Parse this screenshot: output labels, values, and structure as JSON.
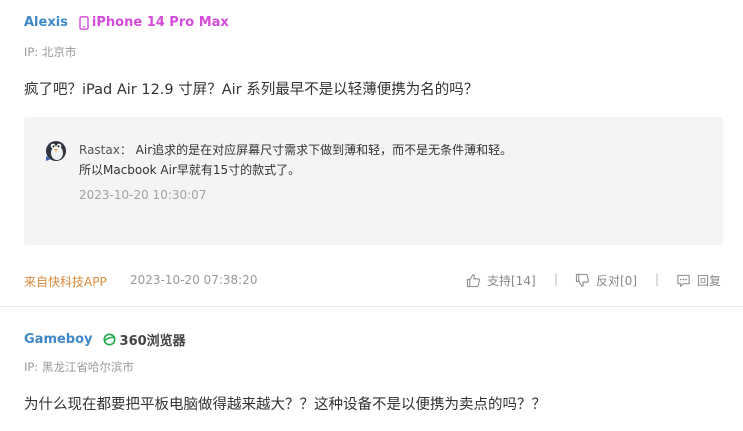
{
  "comments": [
    {
      "username": "Alexis",
      "device": "iPhone 14 Pro Max",
      "device_icon": "phone-icon",
      "ip": "IP: 北京市",
      "content": "疯了吧？iPad Air 12.9 寸屏？Air 系列最早不是以轻薄便携为名的吗？",
      "quote": {
        "avatar_icon": "penguin-avatar",
        "name": "Rastax：",
        "text_line1": "Air追求的是在对应屏幕尺寸需求下做到薄和轻，而不是无条件薄和轻。",
        "text_line2": "所以Macbook Air早就有15寸的款式了。",
        "time": "2023-10-20 10:30:07"
      },
      "footer": {
        "source": "来自快科技APP",
        "time": "2023-10-20 07:38:20",
        "support": "支持[14]",
        "oppose": "反对[0]",
        "reply": "回复",
        "separator": "|"
      }
    },
    {
      "username": "Gameboy",
      "device": "360浏览器",
      "device_icon": "browser-360-icon",
      "ip": "IP: 黑龙江省哈尔滨市",
      "content": "为什么现在都要把平板电脑做得越来越大？？这种设备不是以便携为卖点的吗？？"
    }
  ],
  "colors": {
    "username": "#3e88c7",
    "iphone_device": "#d44ad9",
    "source": "#d98b3a",
    "browser_icon": "#22a94c"
  }
}
